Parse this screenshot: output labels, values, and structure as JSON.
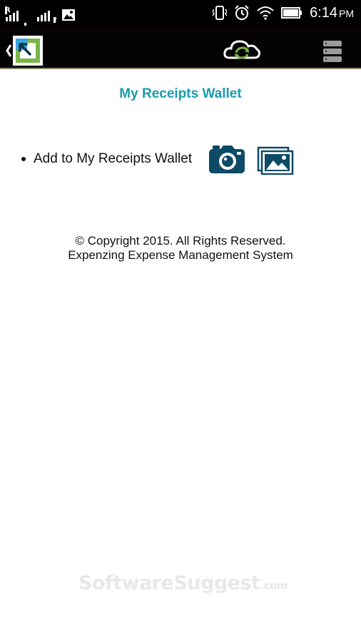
{
  "status_bar": {
    "sim1_label": "R",
    "sim2_badge": "2",
    "time": "6:14",
    "ampm": "PM"
  },
  "header": {
    "back_icon": "back-arrow-logo-icon",
    "sync_icon": "cloud-sync-icon",
    "menu_icon": "database-menu-icon"
  },
  "main": {
    "title": "My Receipts Wallet",
    "add_item": {
      "label": "Add to My Receipts Wallet",
      "camera_icon": "camera-icon",
      "gallery_icon": "gallery-icon"
    }
  },
  "footer": {
    "copyright": "© Copyright 2015. All Rights Reserved.",
    "system_name": "Expenzing Expense Management System"
  },
  "watermark": {
    "text": "SoftwareSuggest",
    "suffix": ".com"
  },
  "colors": {
    "accent": "#1a9bb0",
    "icon_dark": "#0d4a66",
    "green": "#7ab648",
    "bar": "#050203"
  }
}
